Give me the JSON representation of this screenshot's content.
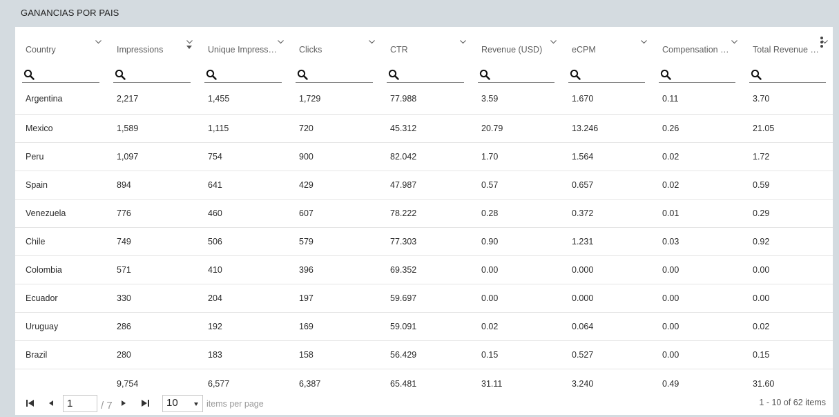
{
  "panel": {
    "title": "GANANCIAS POR PAIS"
  },
  "columns": [
    {
      "label": "Country"
    },
    {
      "label": "Impressions",
      "sorted": "desc"
    },
    {
      "label": "Unique Impressio..."
    },
    {
      "label": "Clicks"
    },
    {
      "label": "CTR"
    },
    {
      "label": "Revenue (USD)"
    },
    {
      "label": "eCPM"
    },
    {
      "label": "Compensation (Ú..."
    },
    {
      "label": "Total Revenue (U..."
    }
  ],
  "filter_icon": "search-icon",
  "rows": [
    [
      "Argentina",
      "2,217",
      "1,455",
      "1,729",
      "77.988",
      "3.59",
      "1.670",
      "0.11",
      "3.70"
    ],
    [
      "Mexico",
      "1,589",
      "1,115",
      "720",
      "45.312",
      "20.79",
      "13.246",
      "0.26",
      "21.05"
    ],
    [
      "Peru",
      "1,097",
      "754",
      "900",
      "82.042",
      "1.70",
      "1.564",
      "0.02",
      "1.72"
    ],
    [
      "Spain",
      "894",
      "641",
      "429",
      "47.987",
      "0.57",
      "0.657",
      "0.02",
      "0.59"
    ],
    [
      "Venezuela",
      "776",
      "460",
      "607",
      "78.222",
      "0.28",
      "0.372",
      "0.01",
      "0.29"
    ],
    [
      "Chile",
      "749",
      "506",
      "579",
      "77.303",
      "0.90",
      "1.231",
      "0.03",
      "0.92"
    ],
    [
      "Colombia",
      "571",
      "410",
      "396",
      "69.352",
      "0.00",
      "0.000",
      "0.00",
      "0.00"
    ],
    [
      "Ecuador",
      "330",
      "204",
      "197",
      "59.697",
      "0.00",
      "0.000",
      "0.00",
      "0.00"
    ],
    [
      "Uruguay",
      "286",
      "192",
      "169",
      "59.091",
      "0.02",
      "0.064",
      "0.00",
      "0.02"
    ],
    [
      "Brazil",
      "280",
      "183",
      "158",
      "56.429",
      "0.15",
      "0.527",
      "0.00",
      "0.15"
    ]
  ],
  "totals": [
    "",
    "9,754",
    "6,577",
    "6,387",
    "65.481",
    "31.11",
    "3.240",
    "0.49",
    "31.60"
  ],
  "pager": {
    "current_page": "1",
    "total_pages_label": "/ 7",
    "items_per_page": "10",
    "items_per_page_label": "items per page",
    "range_label": "1 - 10 of 62 items"
  },
  "colors": {
    "background": "#d4dbe0",
    "card": "#ffffff",
    "row_border": "#e4e4e4"
  }
}
